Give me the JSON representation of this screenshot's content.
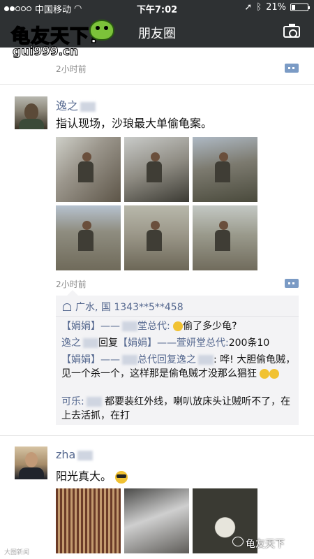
{
  "status": {
    "carrier": "中国移动",
    "time": "下午7:02",
    "battery": "21%",
    "battery_level": 0.21
  },
  "nav": {
    "title": "朋友圈"
  },
  "watermark": {
    "title": "龟友天下!",
    "url": "gui999.cn"
  },
  "prev_post": {
    "time": "2小时前"
  },
  "post1": {
    "user": "逸之",
    "text": "指认现场，沙琅最大单偷龟案。",
    "time": "2小时前",
    "likes": "广水, 国  1343**5**458",
    "comments": [
      {
        "a": "【娟娟】",
        "b": "——",
        "c": "堂总代:",
        "text": "偷了多少龟?"
      },
      {
        "a": "逸之",
        "b": "回复",
        "c": "【娟娟】——萱妍堂总代:",
        "text": "200条10"
      },
      {
        "a": "【娟娟】——",
        "b": "总代",
        "c": "回复逸之",
        "text": ": 哗! 大胆偷龟贼，见一个杀一个，这样那是偷龟贼才没那么猖狂"
      },
      {
        "a": "可乐:",
        "text": "都要装红外线，喇叭放床头让贼听不了，在上去活抓，在打"
      }
    ]
  },
  "post2": {
    "user": "zha",
    "text": "阳光真大。"
  },
  "footer_watermark": {
    "brand": "龟友天下",
    "left": "大图新闻"
  }
}
